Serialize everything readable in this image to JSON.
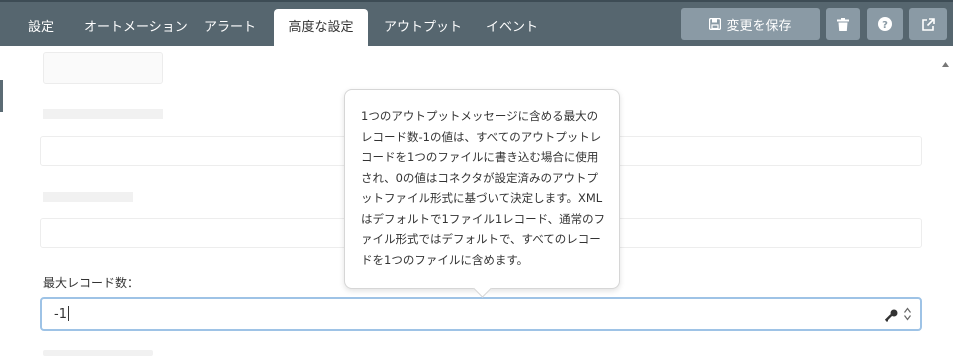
{
  "tabs": [
    {
      "label": "設定",
      "active": false
    },
    {
      "label": "オートメーション",
      "active": false
    },
    {
      "label": "アラート",
      "active": false
    },
    {
      "label": "高度な設定",
      "active": true
    },
    {
      "label": "アウトプット",
      "active": false
    },
    {
      "label": "イベント",
      "active": false
    }
  ],
  "toolbar": {
    "save_label": "変更を保存",
    "save_icon": "floppy-disk-icon",
    "delete_icon": "trash-icon",
    "help_icon": "question-icon",
    "external_icon": "external-link-icon"
  },
  "field": {
    "label": "最大レコード数：",
    "value": "-1",
    "key_icon": "key-icon",
    "spinner_icon": "spinner-arrows-icon"
  },
  "tooltip": {
    "text": "1つのアウトプットメッセージに含める最大のレコード数-1の値は、すべてのアウトプットレコードを1つのファイルに書き込む場合に使用され、0の値はコネクタが設定済みのアウトプットファイル形式に基づいて決定します。XMLはデフォルトで1ファイル1レコード、通常のファイル形式ではデフォルトで、すべてのレコードを1つのファイルに含めます。"
  },
  "colors": {
    "topbar": "#56666f",
    "button": "#8a9aa5",
    "focus_border": "#9ec3e6"
  }
}
